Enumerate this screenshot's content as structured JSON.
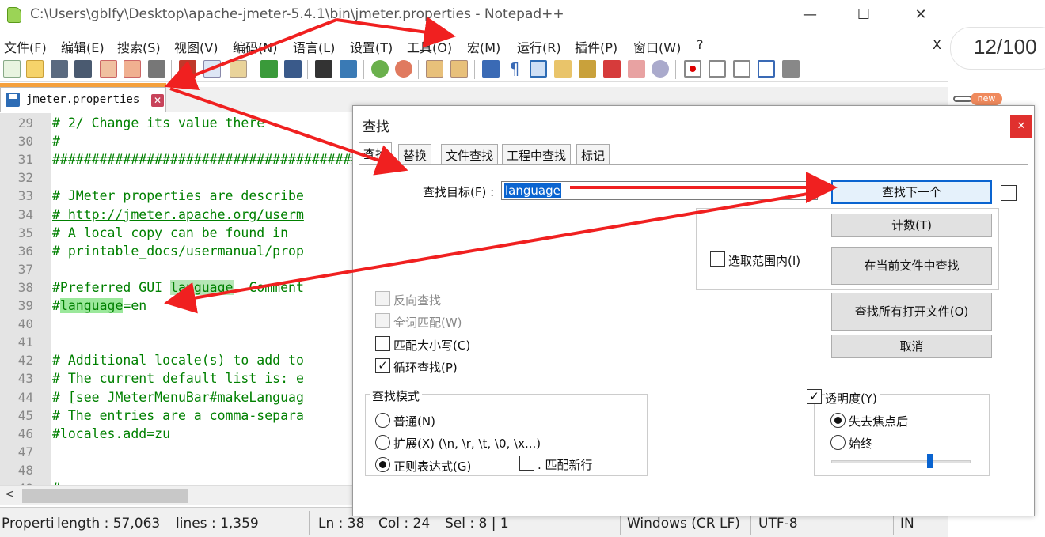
{
  "window": {
    "title": "C:\\Users\\gblfy\\Desktop\\apache-jmeter-5.4.1\\bin\\jmeter.properties - Notepad++",
    "min_glyph": "—",
    "max_glyph": "☐",
    "close_glyph": "✕",
    "menu_close_glyph": "X"
  },
  "menu": [
    "文件(F)",
    "编辑(E)",
    "搜索(S)",
    "视图(V)",
    "编码(N)",
    "语言(L)",
    "设置(T)",
    "工具(O)",
    "宏(M)",
    "运行(R)",
    "插件(P)",
    "窗口(W)",
    "?"
  ],
  "tab": {
    "label": "jmeter.properties",
    "close_glyph": "✕"
  },
  "editor": {
    "lines": [
      {
        "n": "29",
        "text": "# 2/ Change its value there"
      },
      {
        "n": "30",
        "text": "#"
      },
      {
        "n": "31",
        "text": "##########################################"
      },
      {
        "n": "32",
        "text": ""
      },
      {
        "n": "33",
        "text": "# JMeter properties are describe"
      },
      {
        "n": "34",
        "text": "# http://jmeter.apache.org/userm"
      },
      {
        "n": "35",
        "text": "# A local copy can be found in"
      },
      {
        "n": "36",
        "text": "# printable_docs/usermanual/prop"
      },
      {
        "n": "37",
        "text": ""
      },
      {
        "n": "38",
        "pre": "#Preferred GUI ",
        "hl": "language",
        "post": ". Comment"
      },
      {
        "n": "39",
        "pre": "#",
        "hl": "language",
        "post": "=en"
      },
      {
        "n": "40",
        "text": ""
      },
      {
        "n": "41",
        "text": ""
      },
      {
        "n": "42",
        "text": "# Additional locale(s) to add to"
      },
      {
        "n": "43",
        "text": "# The current default list is: e"
      },
      {
        "n": "44",
        "text": "# [see JMeterMenuBar#makeLanguag"
      },
      {
        "n": "45",
        "text": "# The entries are a comma-separa"
      },
      {
        "n": "46",
        "text": "#locales.add=zu"
      },
      {
        "n": "47",
        "text": ""
      },
      {
        "n": "48",
        "text": ""
      },
      {
        "n": "49",
        "text": "#"
      }
    ],
    "scroll_left_glyph": "<"
  },
  "status": {
    "file_type": "Properti",
    "length": "length : 57,063",
    "lines": "lines : 1,359",
    "ln": "Ln : 38",
    "col": "Col : 24",
    "sel": "Sel : 8 | 1",
    "eol": "Windows (CR LF)",
    "encoding": "UTF-8",
    "ins": "IN"
  },
  "side": {
    "page_counter": "12/100",
    "new_badge": "new"
  },
  "dialog": {
    "title": "查找",
    "close_glyph": "✕",
    "tabs": [
      "查找",
      "替换",
      "文件查找",
      "工程中查找",
      "标记"
    ],
    "find_label": "查找目标(F) :",
    "find_value": "language",
    "buttons": {
      "find_next": "查找下一个",
      "count": "计数(T)",
      "find_in_current": "在当前文件中查找",
      "find_all_open": "查找所有打开文件(O)",
      "cancel": "取消"
    },
    "in_selection": "选取范围内(I)",
    "options": {
      "backward": "反向查找",
      "whole_word": "全词匹配(W)",
      "match_case": "匹配大小写(C)",
      "wrap": "循环查找(P)"
    },
    "mode": {
      "title": "查找模式",
      "normal": "普通(N)",
      "extended": "扩展(X) (\\n, \\r, \\t, \\0, \\x...)",
      "regex": "正则表达式(G)",
      "newline": ". 匹配新行"
    },
    "transparency": {
      "title": "透明度(Y)",
      "on_lose_focus": "失去焦点后",
      "always": "始终"
    },
    "check_glyph": "✓"
  }
}
